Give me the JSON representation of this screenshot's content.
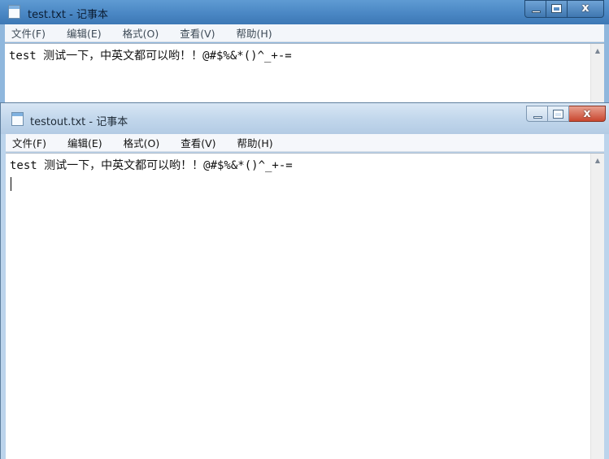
{
  "windows": {
    "back": {
      "title": "test.txt - 记事本",
      "menu": [
        "文件(F)",
        "编辑(E)",
        "格式(O)",
        "查看(V)",
        "帮助(H)"
      ],
      "content": "test 测试一下，中英文都可以哟！！@#$%&*()^_+-=",
      "controls": {
        "minimize": "",
        "maximize": "",
        "close": "x"
      }
    },
    "front": {
      "title": "testout.txt - 记事本",
      "menu": [
        "文件(F)",
        "编辑(E)",
        "格式(O)",
        "查看(V)",
        "帮助(H)"
      ],
      "content": "test 测试一下，中英文都可以哟！！@#$%&*()^_+-=",
      "controls": {
        "minimize": "",
        "maximize": "",
        "close": "x"
      }
    }
  },
  "icons": {
    "app": "notepad-icon",
    "minimize": "minimize-icon",
    "maximize": "maximize-icon",
    "close": "close-icon",
    "scroll_up": "chevron-up-icon"
  },
  "colors": {
    "active_titlebar": "#4a87c4",
    "inactive_titlebar": "#c2d7ec",
    "close_button": "#c9472f"
  }
}
